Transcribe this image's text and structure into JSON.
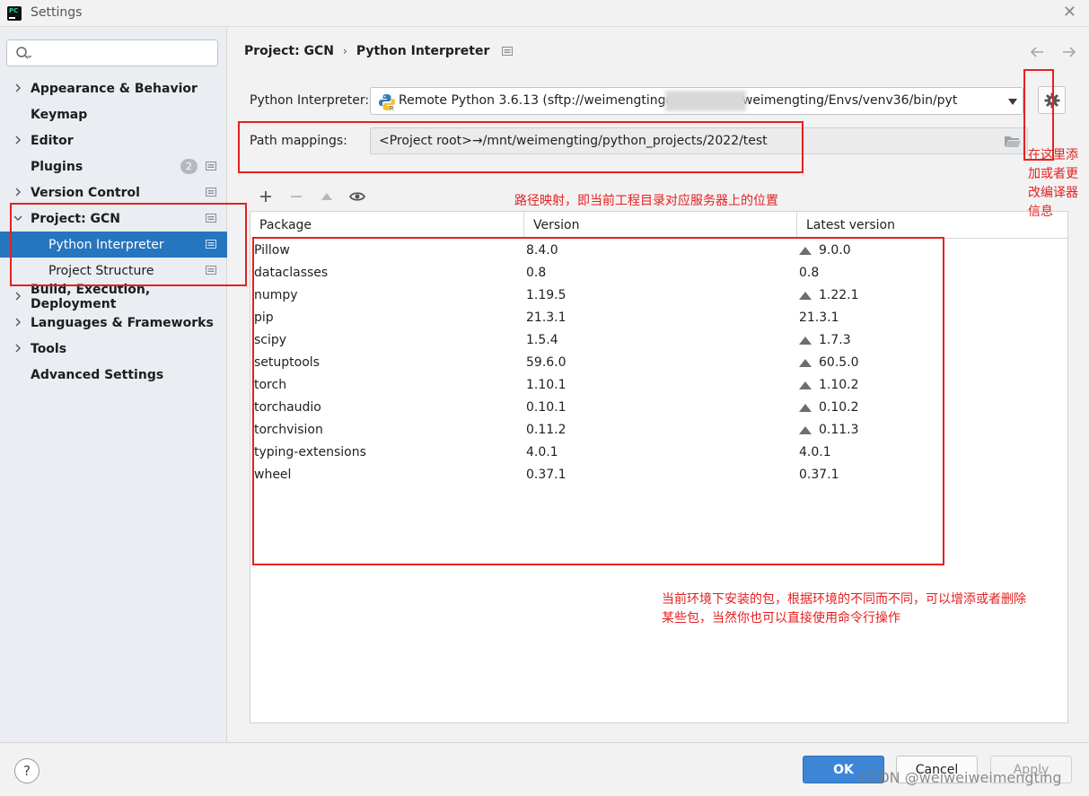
{
  "window": {
    "title": "Settings"
  },
  "sidebar": {
    "search_placeholder": "",
    "items": [
      {
        "label": "Appearance & Behavior"
      },
      {
        "label": "Keymap"
      },
      {
        "label": "Editor"
      },
      {
        "label": "Plugins",
        "badge": "2"
      },
      {
        "label": "Version Control"
      },
      {
        "label": "Project: GCN"
      },
      {
        "label": "Python Interpreter"
      },
      {
        "label": "Project Structure"
      },
      {
        "label": "Build, Execution, Deployment"
      },
      {
        "label": "Languages & Frameworks"
      },
      {
        "label": "Tools"
      },
      {
        "label": "Advanced Settings"
      }
    ]
  },
  "breadcrumb": {
    "project": "Project: GCN",
    "page": "Python Interpreter"
  },
  "interpreter": {
    "label": "Python Interpreter:",
    "value": "Remote Python 3.6.13 (sftp://weimengting@1                2/home/weimengting/Envs/venv36/bin/pyt"
  },
  "path_mappings": {
    "label": "Path mappings:",
    "value": "<Project root>→/mnt/weimengting/python_projects/2022/test"
  },
  "packages": {
    "columns": [
      "Package",
      "Version",
      "Latest version"
    ],
    "rows": [
      {
        "name": "Pillow",
        "version": "8.4.0",
        "latest": "9.0.0",
        "upgrade": true
      },
      {
        "name": "dataclasses",
        "version": "0.8",
        "latest": "0.8",
        "upgrade": false
      },
      {
        "name": "numpy",
        "version": "1.19.5",
        "latest": "1.22.1",
        "upgrade": true
      },
      {
        "name": "pip",
        "version": "21.3.1",
        "latest": "21.3.1",
        "upgrade": false
      },
      {
        "name": "scipy",
        "version": "1.5.4",
        "latest": "1.7.3",
        "upgrade": true
      },
      {
        "name": "setuptools",
        "version": "59.6.0",
        "latest": "60.5.0",
        "upgrade": true
      },
      {
        "name": "torch",
        "version": "1.10.1",
        "latest": "1.10.2",
        "upgrade": true
      },
      {
        "name": "torchaudio",
        "version": "0.10.1",
        "latest": "0.10.2",
        "upgrade": true
      },
      {
        "name": "torchvision",
        "version": "0.11.2",
        "latest": "0.11.3",
        "upgrade": true
      },
      {
        "name": "typing-extensions",
        "version": "4.0.1",
        "latest": "4.0.1",
        "upgrade": false
      },
      {
        "name": "wheel",
        "version": "0.37.1",
        "latest": "0.37.1",
        "upgrade": false
      }
    ]
  },
  "annotations": {
    "path_note": "路径映射，即当前工程目录对应服务器上的位置",
    "side_note": "在这里添加或者更改编译器信息",
    "packages_note_line1": "当前环境下安装的包，根据环境的不同而不同，可以增添或者删除",
    "packages_note_line2": "某些包，当然你也可以直接使用命令行操作",
    "color": "#e62020"
  },
  "footer": {
    "help": "?",
    "ok": "OK",
    "cancel": "Cancel",
    "apply": "Apply",
    "watermark": "CSDN @weiweiweimengting"
  },
  "colors": {
    "selected": "#2675bf",
    "ok_button": "#3d86d6"
  },
  "icons": [
    "pycharm-icon",
    "close-icon",
    "search-icon",
    "chevron-right-icon",
    "chevron-down-icon",
    "project-scope-icon",
    "back-arrow-icon",
    "forward-arrow-icon",
    "python-icon",
    "gear-icon",
    "folder-icon",
    "add-icon",
    "remove-icon",
    "upgrade-icon",
    "eye-icon"
  ]
}
